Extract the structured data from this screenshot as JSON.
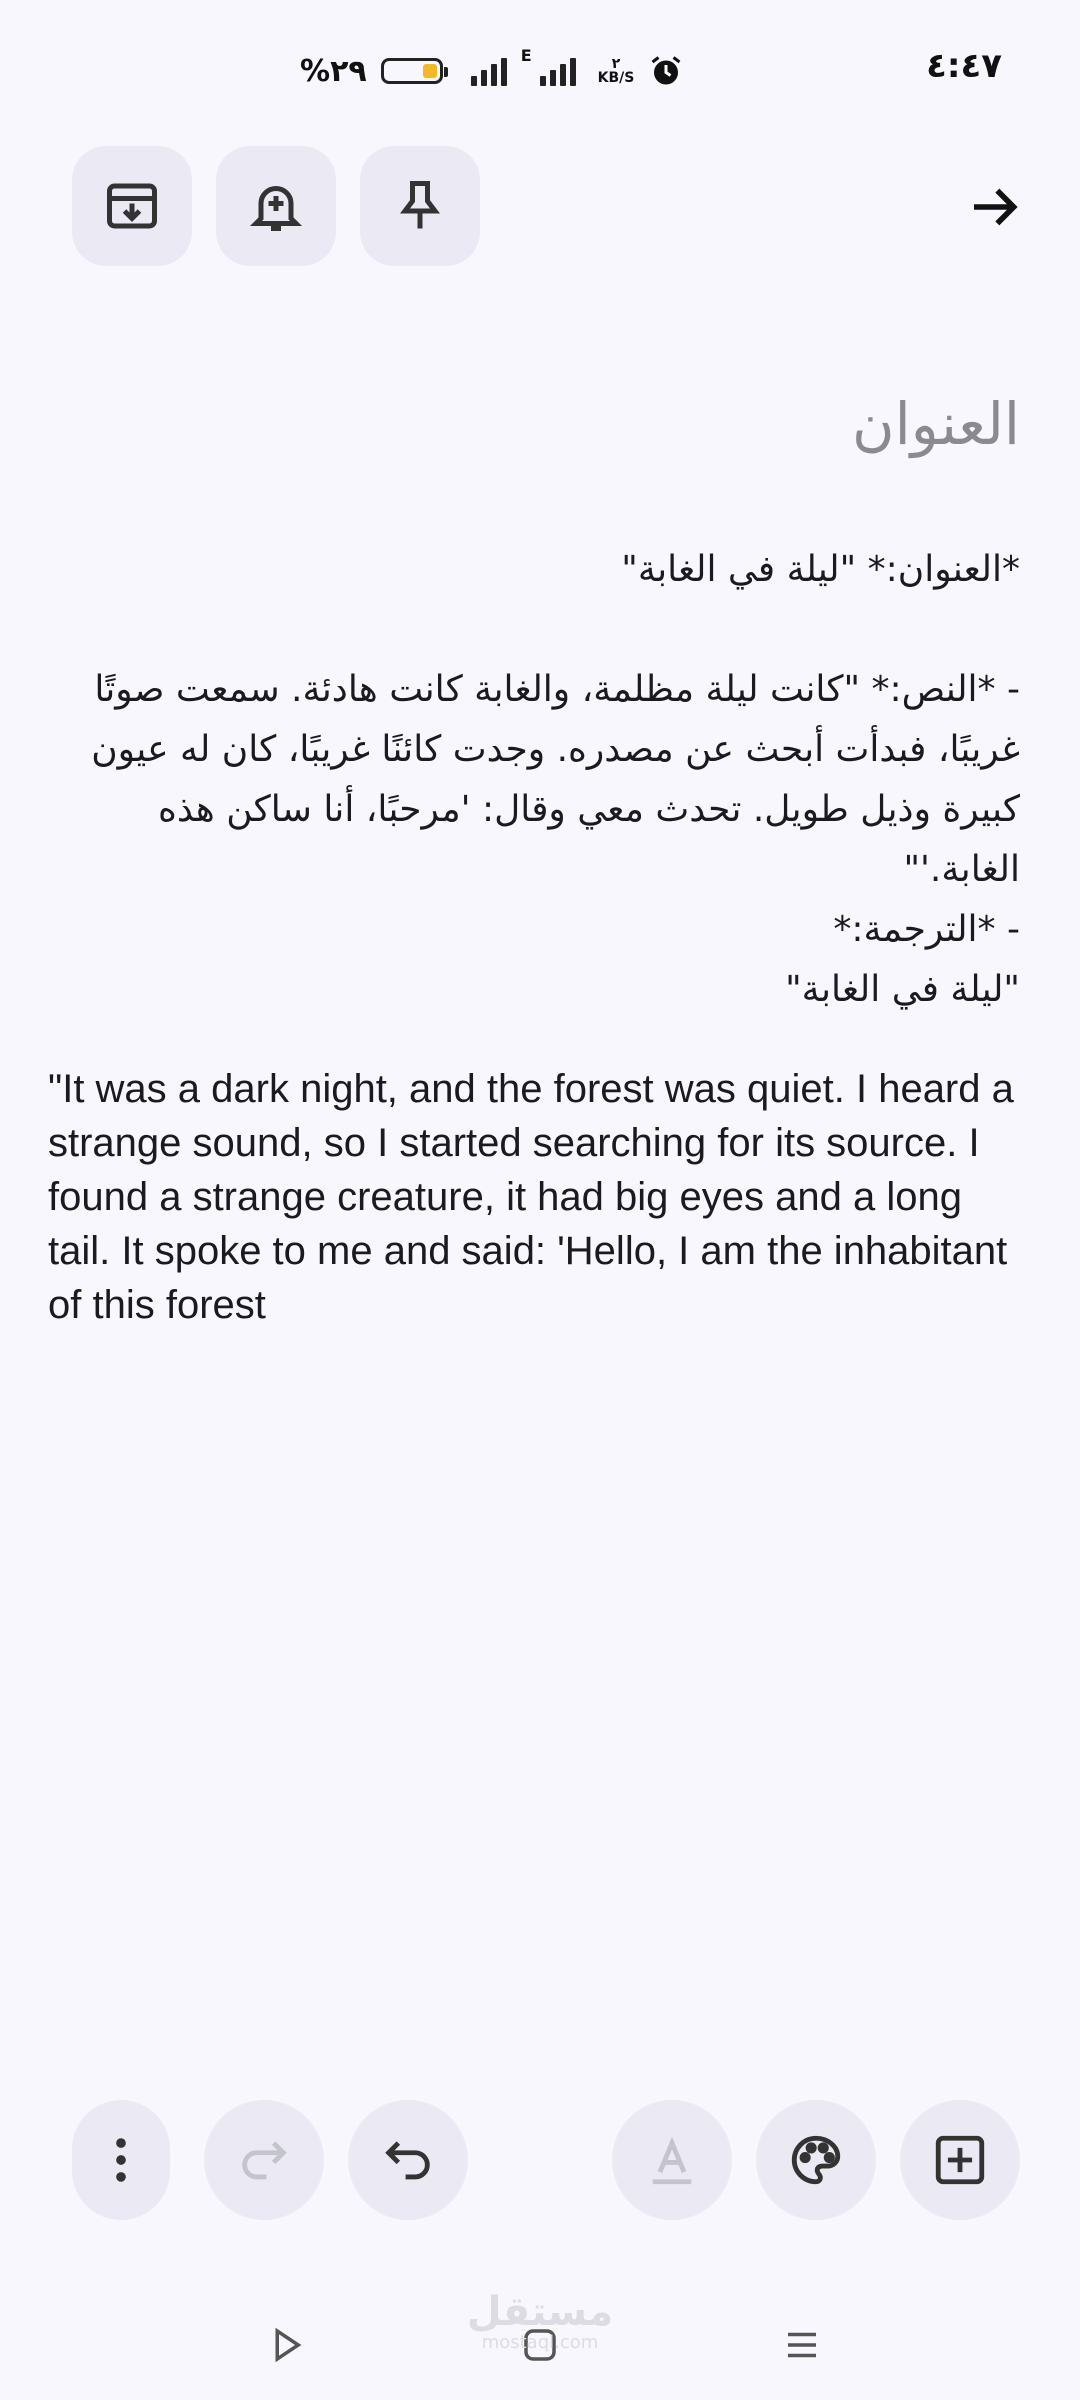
{
  "status_bar": {
    "time": "٤:٤٧",
    "battery_percent": "%٢٩",
    "battery_level": 0.29,
    "network_speed_value": "٢",
    "network_speed_unit": "KB/S",
    "network_type": "E",
    "icons": [
      "battery-icon",
      "signal-icon",
      "signal-e-icon",
      "alarm-icon"
    ]
  },
  "toolbar": {
    "buttons": [
      "archive-icon",
      "add-reminder-icon",
      "pin-icon",
      "back-arrow-icon"
    ]
  },
  "note": {
    "title_placeholder": "العنوان",
    "arabic_heading": "*العنوان:* \"ليلة في الغابة\"",
    "arabic_body": "- *النص:* \"كانت ليلة مظلمة، والغابة كانت هادئة. سمعت صوتًا غريبًا، فبدأت أبحث عن مصدره. وجدت كائنًا غريبًا، كان له عيون كبيرة وذيل طويل. تحدث معي وقال: 'مرحبًا، أنا ساكن هذه الغابة.'\"",
    "arabic_translation_label": "- *الترجمة:*",
    "arabic_translation_title": "\"ليلة في الغابة\"",
    "english_text": "\"It was a dark night, and the forest was quiet. I heard a strange sound, so I started searching for its source. I found a strange creature, it had big eyes and a long tail. It spoke to me and said: 'Hello, I am the inhabitant of this forest"
  },
  "bottom_toolbar": {
    "buttons": [
      "more-options-icon",
      "redo-icon",
      "undo-icon",
      "text-format-icon",
      "palette-icon",
      "add-box-icon"
    ]
  },
  "nav_bar": {
    "buttons": [
      "back-triangle-icon",
      "home-square-icon",
      "recents-menu-icon"
    ],
    "watermark_main": "مستقل",
    "watermark_sub": "mostaql.com"
  },
  "colors": {
    "background": "#f8f7fd",
    "button_bg": "#ebeaf4",
    "battery_fill": "#f3b829"
  }
}
